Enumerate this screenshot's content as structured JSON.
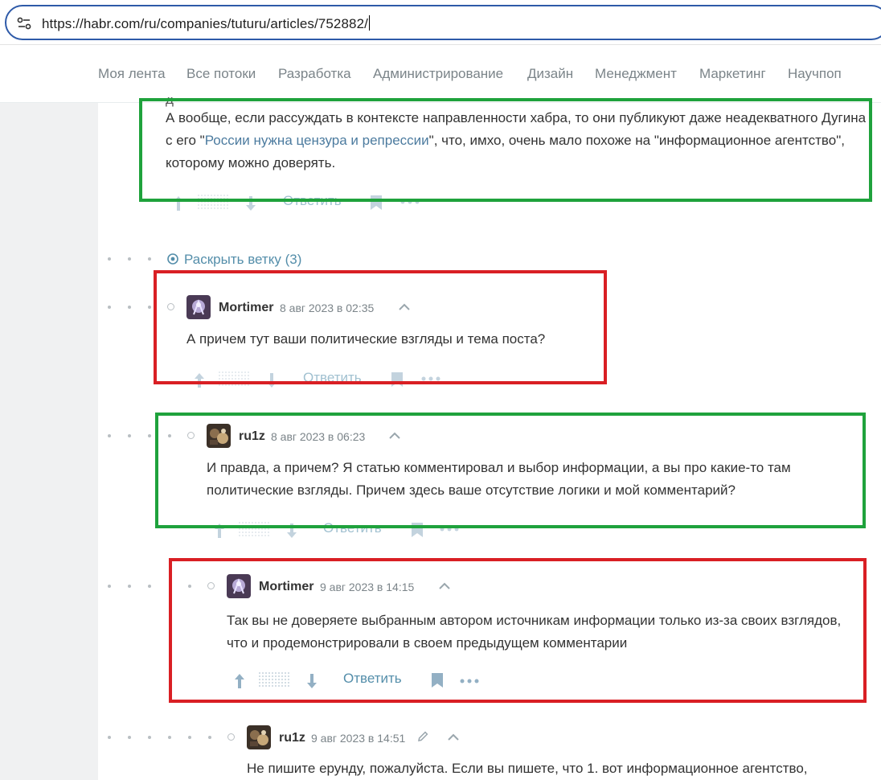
{
  "browser": {
    "url": "https://habr.com/ru/companies/tuturu/articles/752882/"
  },
  "nav": {
    "items": [
      "Моя лента",
      "Все потоки",
      "Разработка",
      "Администрирование",
      "Дизайн",
      "Менеджмент",
      "Маркетинг",
      "Научпоп"
    ]
  },
  "top_comment": {
    "text_prefix": "А вообще, если рассуждать в контексте направленности хабра, то они публикуют даже неадекватного Дугина с его \"",
    "link": "России нужна цензура и репрессии",
    "text_suffix": "\", что, имхо, очень мало похоже на \"информационное агентство\", которому можно доверять.",
    "reply_label": "Ответить"
  },
  "expand_branch": {
    "label": "Раскрыть ветку (3)"
  },
  "comments": [
    {
      "author": "Mortimer",
      "date": "8 авг 2023 в 02:35",
      "text": "А причем тут ваши политические взгляды и тема поста?",
      "reply_label": "Ответить"
    },
    {
      "author": "ru1z",
      "date": "8 авг 2023 в 06:23",
      "text": "И правда, а причем? Я статью комментировал и выбор информации, а вы про какие-то там политические взгляды. Причем здесь ваше отсутствие логики и мой комментарий?",
      "reply_label": "Ответить"
    },
    {
      "author": "Mortimer",
      "date": "9 авг 2023 в 14:15",
      "text": "Так вы не доверяете выбранным автором источникам информации только из-за своих взглядов, что и продемонстрировали в своем предыдущем комментарии",
      "reply_label": "Ответить"
    },
    {
      "author": "ru1z",
      "date": "9 авг 2023 в 14:51",
      "text": "Не пишите ерунду, пожалуйста. Если вы пишете, что 1. вот информационное агентство,"
    }
  ],
  "icons": {
    "upvote": "arrow-up-icon",
    "downvote": "arrow-down-icon",
    "bookmark": "bookmark-icon",
    "more": "more-dots-icon",
    "collapse": "chevron-up-icon",
    "edit": "pencil-icon",
    "expand": "target-circle-icon"
  },
  "colors": {
    "highlight_green": "#1fa23c",
    "highlight_red": "#d91f24",
    "link": "#548eaa",
    "url_bar_border": "#2e5aa8"
  }
}
